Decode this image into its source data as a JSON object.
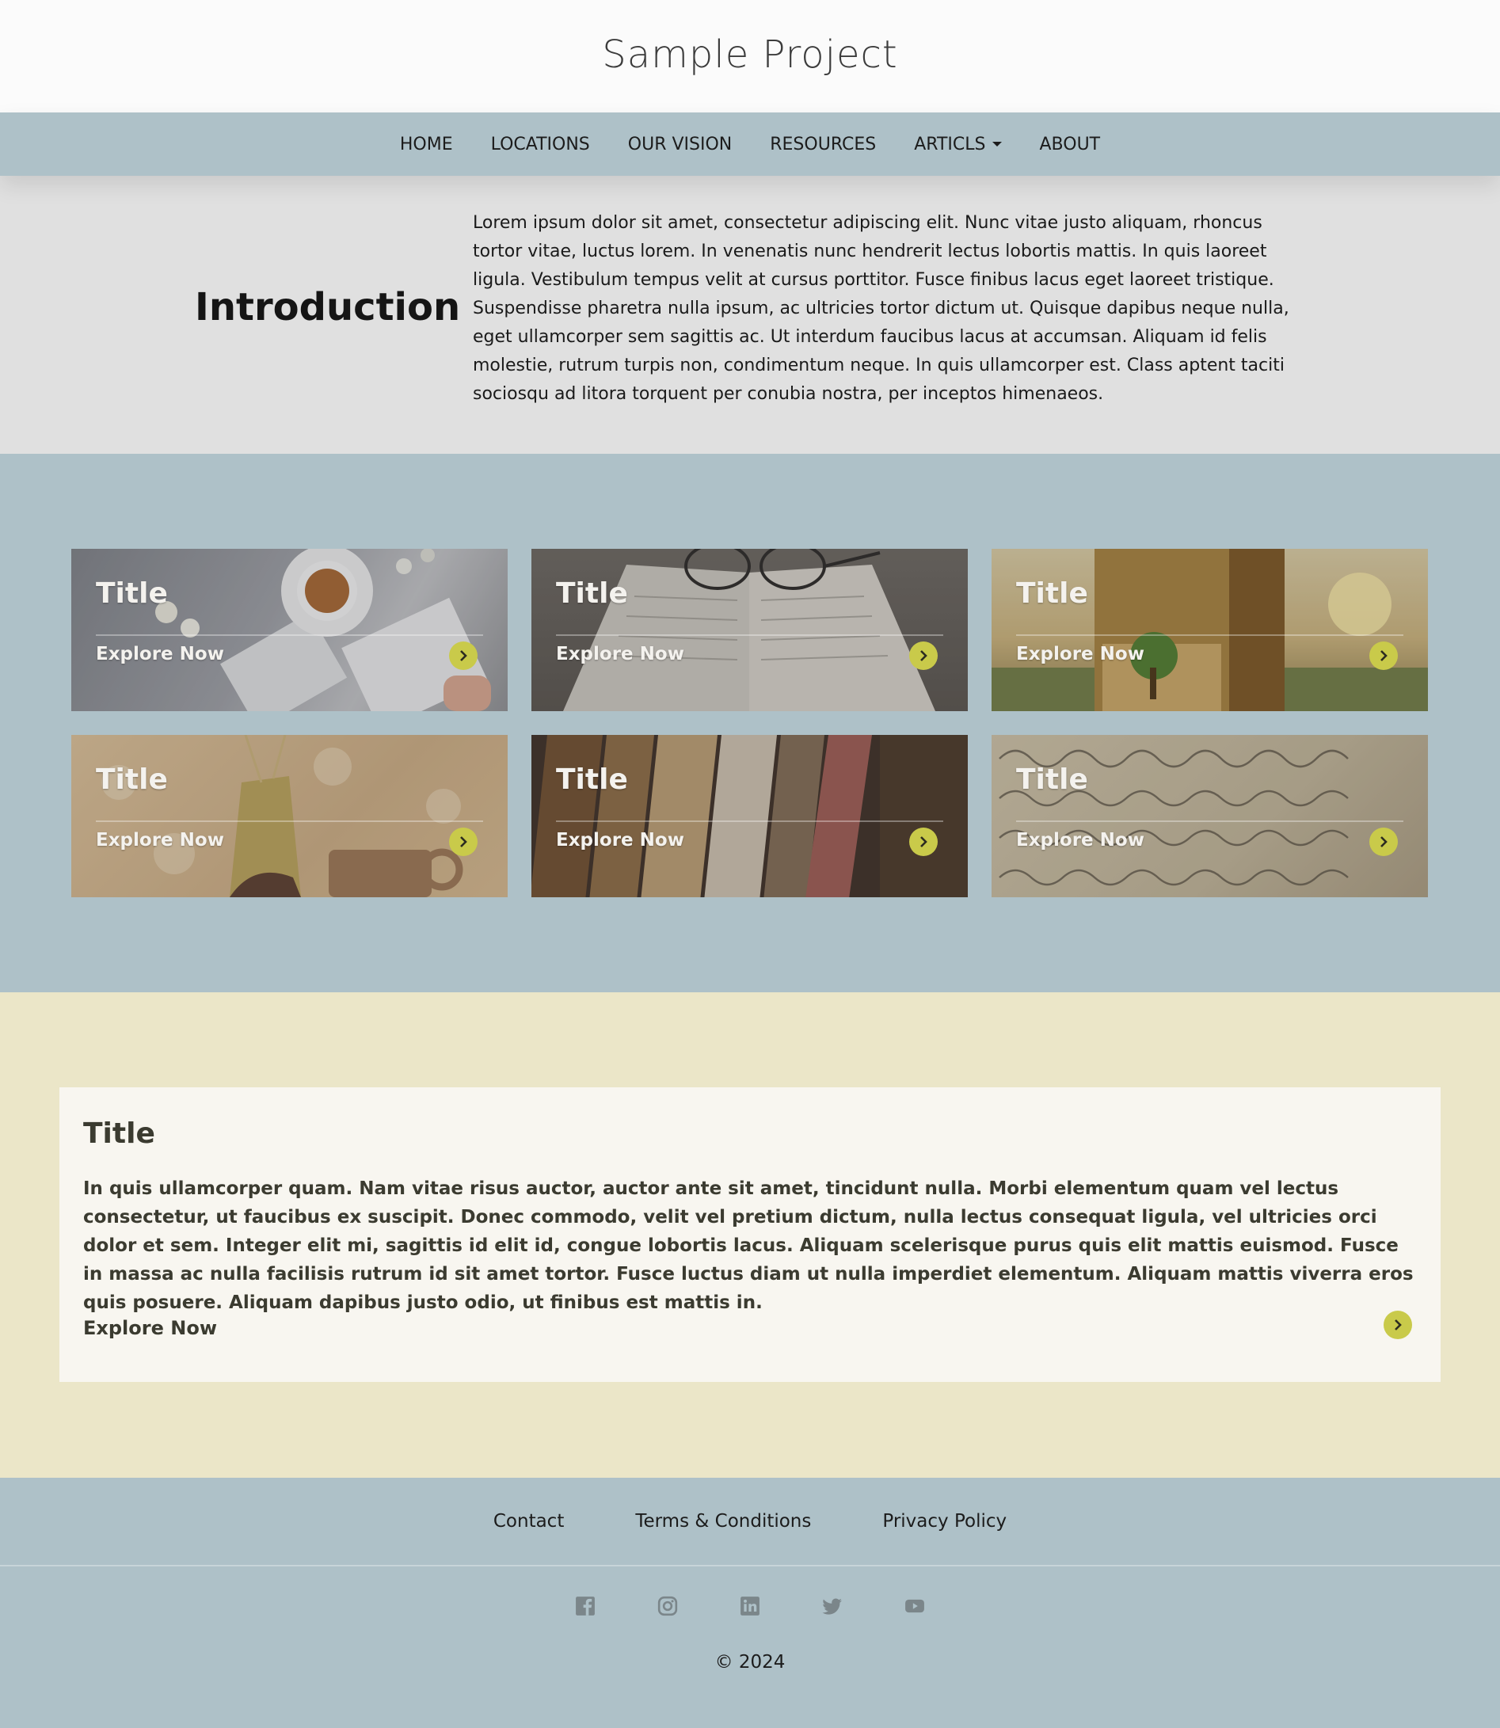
{
  "header": {
    "title": "Sample Project"
  },
  "nav": {
    "items": [
      {
        "label": "HOME"
      },
      {
        "label": "LOCATIONS"
      },
      {
        "label": "OUR VISION"
      },
      {
        "label": "RESOURCES"
      },
      {
        "label": "ARTICLS"
      },
      {
        "label": "ABOUT"
      }
    ]
  },
  "intro": {
    "heading": "Introduction",
    "text": "Lorem ipsum dolor sit amet, consectetur adipiscing elit. Nunc vitae justo aliquam, rhoncus tortor vitae, luctus lorem. In venenatis nunc hendrerit lectus lobortis mattis. In quis laoreet ligula. Vestibulum tempus velit at cursus porttitor. Fusce finibus lacus eget laoreet tristique. Suspendisse pharetra nulla ipsum, ac ultricies tortor dictum ut. Quisque dapibus neque nulla, eget ullamcorper sem sagittis ac. Ut interdum faucibus lacus at accumsan. Aliquam id felis molestie, rutrum turpis non, condimentum neque. In quis ullamcorper est. Class aptent taciti sociosqu ad litora torquent per conubia nostra, per inceptos himenaeos."
  },
  "cards": [
    {
      "title": "Title",
      "link": "Explore Now"
    },
    {
      "title": "Title",
      "link": "Explore Now"
    },
    {
      "title": "Title",
      "link": "Explore Now"
    },
    {
      "title": "Title",
      "link": "Explore Now"
    },
    {
      "title": "Title",
      "link": "Explore Now"
    },
    {
      "title": "Title",
      "link": "Explore Now"
    }
  ],
  "feature": {
    "title": "Title",
    "text": "In quis ullamcorper quam. Nam vitae risus auctor, auctor ante sit amet, tincidunt nulla. Morbi elementum quam vel lectus consectetur, ut faucibus ex suscipit. Donec commodo, velit vel pretium dictum, nulla lectus consequat ligula, vel ultricies orci dolor et sem. Integer elit mi, sagittis id elit id, congue lobortis lacus. Aliquam scelerisque purus quis elit mattis euismod. Fusce in massa ac nulla facilisis rutrum id sit amet tortor. Fusce luctus diam ut nulla imperdiet elementum. Aliquam mattis viverra eros quis posuere. Aliquam dapibus justo odio, ut finibus est mattis in.",
    "link": "Explore Now"
  },
  "footer": {
    "links": [
      {
        "label": "Contact"
      },
      {
        "label": "Terms & Conditions"
      },
      {
        "label": "Privacy Policy"
      }
    ],
    "social_icons": [
      "facebook-icon",
      "instagram-icon",
      "linkedin-icon",
      "twitter-icon",
      "youtube-icon"
    ],
    "copyright": "© 2024"
  },
  "colors": {
    "accent": "#c9ca4a",
    "nav_bg": "#aec1c8",
    "intro_bg": "#e0e0e0",
    "feature_bg": "#ebe6c8"
  }
}
